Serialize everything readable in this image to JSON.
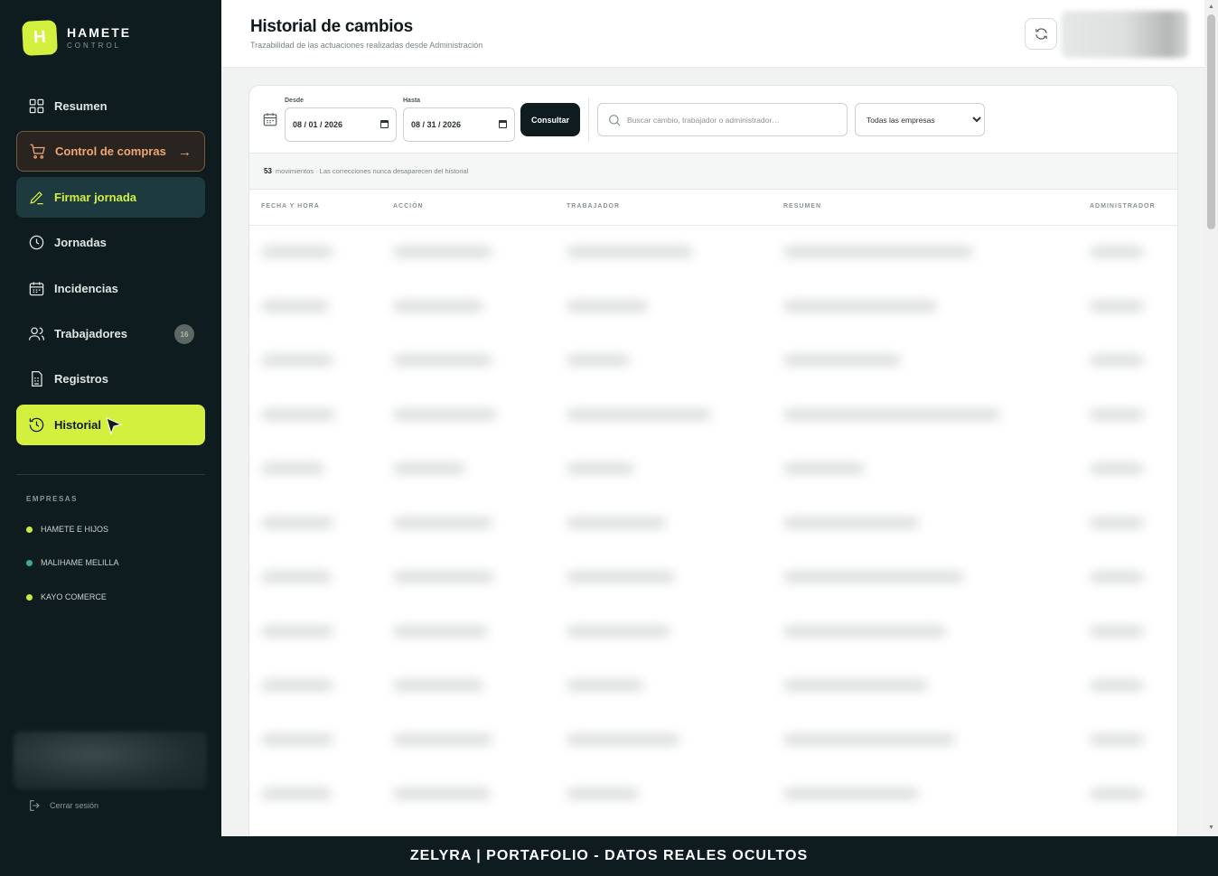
{
  "brand": {
    "logo_letter": "H",
    "name": "HAMETE",
    "subtitle": "CONTROL",
    "accent_color": "#d4f03f"
  },
  "sidebar": {
    "items": [
      {
        "label": "Resumen",
        "icon": "grid-icon"
      },
      {
        "label": "Control de compras",
        "icon": "cart-icon",
        "arrow": "→"
      },
      {
        "label": "Firmar jornada",
        "icon": "pen-icon"
      },
      {
        "label": "Jornadas",
        "icon": "clock-icon"
      },
      {
        "label": "Incidencias",
        "icon": "calendar-icon"
      },
      {
        "label": "Trabajadores",
        "icon": "users-icon",
        "badge": "16"
      },
      {
        "label": "Registros",
        "icon": "document-icon"
      },
      {
        "label": "Historial",
        "icon": "history-icon",
        "active": true
      }
    ],
    "section_label": "EMPRESAS",
    "companies": [
      {
        "name": "HAMETE E HIJOS",
        "color": "#c8ec3f"
      },
      {
        "name": "MALIHAME MELILLA",
        "color": "#3aa89a"
      },
      {
        "name": "KAYO COMERCE",
        "color": "#c8ec3f"
      }
    ],
    "logout_label": "Cerrar sesión"
  },
  "header": {
    "title": "Historial de cambios",
    "subtitle": "Trazabilidad de las actuaciones realizadas desde Administración"
  },
  "filters": {
    "from_label": "Desde",
    "from_value": "08 / 01 / 2026",
    "to_label": "Hasta",
    "to_value": "08 / 31 / 2026",
    "consult_label": "Consultar",
    "search_placeholder": "Buscar cambio, trabajador o administrador…",
    "company_select": "Todas las empresas"
  },
  "summary": {
    "count": "53",
    "text": "movimientos · Las correcciones nunca desaparecen del historial"
  },
  "table": {
    "columns": [
      "FECHA Y HORA",
      "ACCIÓN",
      "TRABAJADOR",
      "RESUMEN",
      "ADMINISTRADOR"
    ]
  },
  "banner": {
    "text": "ZELYRA | PORTAFOLIO - DATOS REALES OCULTOS"
  }
}
